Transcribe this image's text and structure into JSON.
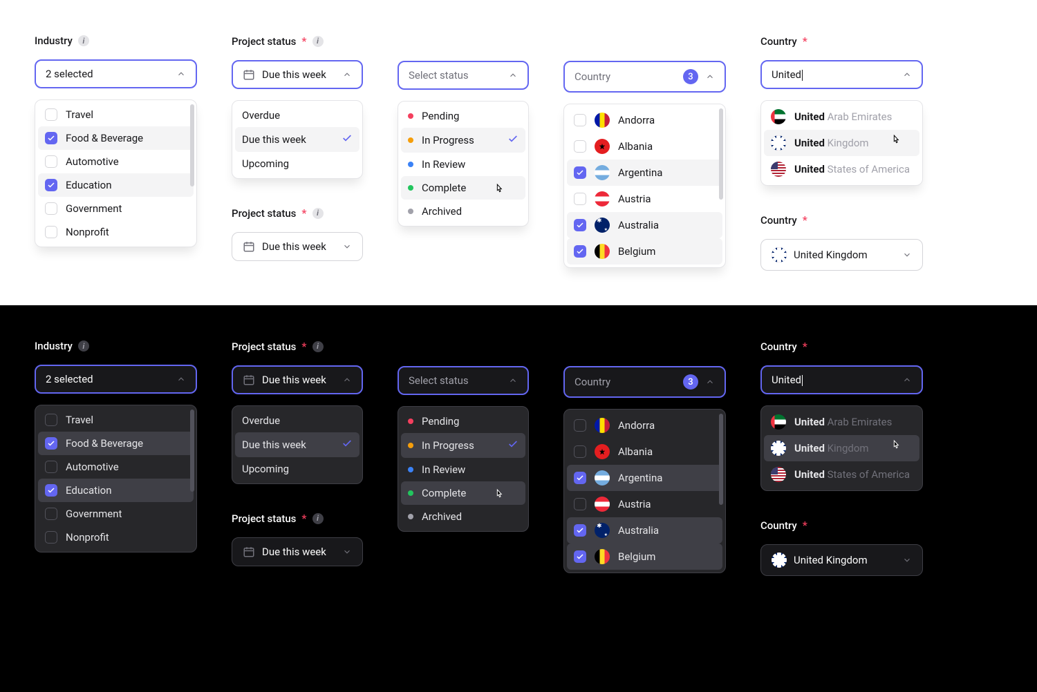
{
  "labels": {
    "industry": "Industry",
    "project_status": "Project status",
    "country": "Country"
  },
  "industry": {
    "trigger": "2 selected",
    "items": [
      "Travel",
      "Food & Beverage",
      "Automotive",
      "Education",
      "Government",
      "Nonprofit"
    ],
    "checked": [
      false,
      true,
      false,
      true,
      false,
      false
    ]
  },
  "project_status": {
    "trigger": "Due this week",
    "closed_trigger": "Due this week",
    "items": [
      "Overdue",
      "Due this week",
      "Upcoming"
    ],
    "selected_index": 1
  },
  "status_select": {
    "placeholder": "Select status",
    "items": [
      "Pending",
      "In Progress",
      "In Review",
      "Complete",
      "Archived"
    ],
    "dot_colors": [
      "#f43f5e",
      "#f59e0b",
      "#3b82f6",
      "#22c55e",
      "#a1a1aa"
    ],
    "selected_index": 1,
    "hover_index": 3
  },
  "country_multi": {
    "placeholder": "Country",
    "badge": "3",
    "items": [
      "Andorra",
      "Albania",
      "Argentina",
      "Austria",
      "Australia",
      "Belgium"
    ],
    "flag_classes": [
      "flag-ad",
      "flag-al",
      "flag-ar",
      "flag-at",
      "flag-au",
      "flag-be"
    ],
    "checked": [
      false,
      false,
      true,
      false,
      true,
      true
    ]
  },
  "country_search": {
    "input": "United",
    "results": [
      {
        "match": "United",
        "rest": " Arab Emirates",
        "flag": "flag-ae"
      },
      {
        "match": "United",
        "rest": " Kingdom",
        "flag": "flag-gb"
      },
      {
        "match": "United",
        "rest": " States of America",
        "flag": "flag-us"
      }
    ],
    "hover_index": 1,
    "closed_value": "United Kingdom",
    "closed_flag": "flag-gb"
  }
}
